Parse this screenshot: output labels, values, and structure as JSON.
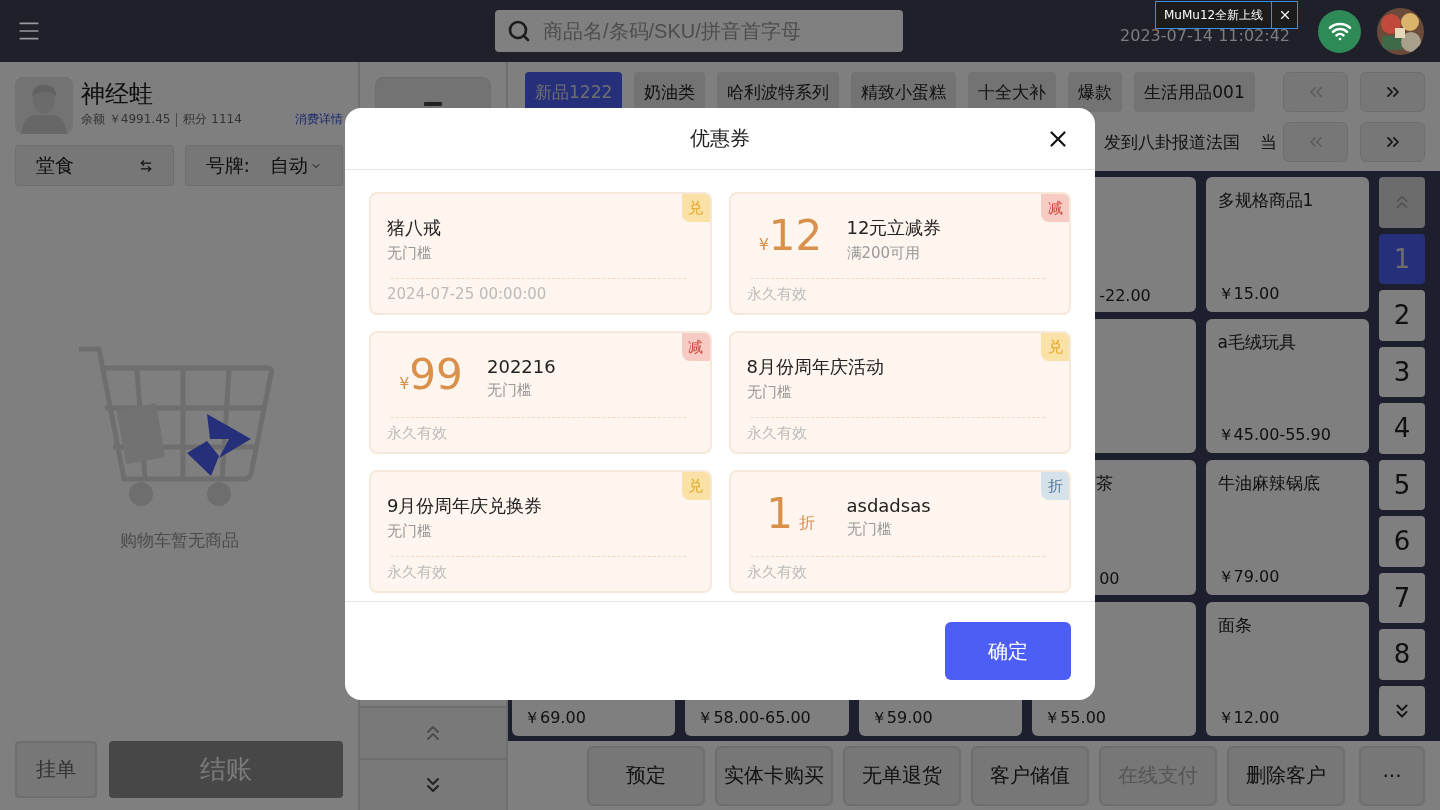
{
  "top_bar": {
    "search": {
      "placeholder": "商品名/条码/SKU/拼音首字母"
    },
    "datetime": "2023-07-14 11:02:42",
    "notice": {
      "text": "MuMu12全新上线"
    }
  },
  "customer": {
    "name": "神经蛙",
    "balance": "余额 ￥4991.45",
    "points": "积分 1114",
    "details_link": "消费详情"
  },
  "order_type": {
    "label": "堂食"
  },
  "number_plate": {
    "label": "号牌:",
    "value": "自动"
  },
  "cart": {
    "empty_text": "购物车暂无商品"
  },
  "cart_actions": [
    {
      "label": "挂单",
      "kind": "secondary",
      "disabled": false
    },
    {
      "label": "结账",
      "kind": "primary",
      "disabled": true
    }
  ],
  "categories": [
    {
      "label": "新品1222",
      "selected": true
    },
    {
      "label": "奶油类",
      "selected": false
    },
    {
      "label": "哈利波特系列",
      "selected": false
    },
    {
      "label": "精致小蛋糕",
      "selected": false
    },
    {
      "label": "十全大补",
      "selected": false
    },
    {
      "label": "爆款",
      "selected": false
    },
    {
      "label": "生活用品001",
      "selected": false
    }
  ],
  "subcategories": [
    {
      "label": "发到八卦报道法国"
    },
    {
      "label": "当"
    }
  ],
  "products": [
    [
      {
        "kind": "hidden"
      },
      {
        "kind": "hidden"
      },
      {
        "kind": "hidden"
      },
      {
        "kind": "partial",
        "price": "-22.00"
      },
      {
        "kind": "full",
        "name": "多规格商品1",
        "price": "￥15.00"
      }
    ],
    [
      {
        "kind": "hidden"
      },
      {
        "kind": "hidden"
      },
      {
        "kind": "hidden"
      },
      {
        "kind": "covered"
      },
      {
        "kind": "full",
        "name": "a毛绒玩具",
        "price": "￥45.00-55.90"
      }
    ],
    [
      {
        "kind": "hidden"
      },
      {
        "kind": "hidden"
      },
      {
        "kind": "hidden"
      },
      {
        "kind": "partial",
        "name": "茶",
        "price": "00"
      },
      {
        "kind": "full",
        "name": "牛油麻辣锅底",
        "price": "￥79.00"
      }
    ],
    [
      {
        "kind": "full",
        "price": "￥69.00"
      },
      {
        "kind": "full",
        "price": "￥58.00-65.00"
      },
      {
        "kind": "full",
        "price": "￥59.00"
      },
      {
        "kind": "full",
        "price": "￥55.00"
      },
      {
        "kind": "full",
        "name": "面条",
        "price": "￥12.00"
      }
    ]
  ],
  "pages": [
    {
      "label": "1",
      "selected": true
    },
    {
      "label": "2",
      "selected": false
    },
    {
      "label": "3",
      "selected": false
    },
    {
      "label": "4",
      "selected": false
    },
    {
      "label": "5",
      "selected": false
    },
    {
      "label": "6",
      "selected": false
    },
    {
      "label": "7",
      "selected": false
    },
    {
      "label": "8",
      "selected": false
    }
  ],
  "bottom_actions": [
    {
      "label": "预定",
      "disabled": false
    },
    {
      "label": "实体卡购买",
      "disabled": false
    },
    {
      "label": "无单退货",
      "disabled": false
    },
    {
      "label": "客户储值",
      "disabled": false
    },
    {
      "label": "在线支付",
      "disabled": true
    },
    {
      "label": "删除客户",
      "disabled": false
    },
    {
      "label": "···",
      "disabled": false
    }
  ],
  "dialog": {
    "title": "优惠券",
    "confirm": "确定",
    "coupons": [
      {
        "title": "猪八戒",
        "condition": "无门槛",
        "validity": "2024-07-25 00:00:00",
        "tag": {
          "text": "兑",
          "kind": "exchange"
        }
      },
      {
        "amount": {
          "prefix": "¥",
          "value": "12"
        },
        "title": "12元立减券",
        "condition": "满200可用",
        "validity": "永久有效",
        "tag": {
          "text": "减",
          "kind": "reduce"
        }
      },
      {
        "amount": {
          "prefix": "¥",
          "value": "99"
        },
        "title": "202216",
        "condition": "无门槛",
        "validity": "永久有效",
        "tag": {
          "text": "减",
          "kind": "reduce"
        }
      },
      {
        "title": "8月份周年庆活动",
        "condition": "无门槛",
        "validity": "永久有效",
        "tag": {
          "text": "兑",
          "kind": "exchange"
        }
      },
      {
        "title": "9月份周年庆兑换券",
        "condition": "无门槛",
        "validity": "永久有效",
        "tag": {
          "text": "兑",
          "kind": "exchange"
        }
      },
      {
        "amount": {
          "value": "1",
          "suffix": "折"
        },
        "title": "asdadsas",
        "condition": "无门槛",
        "validity": "永久有效",
        "tag": {
          "text": "折",
          "kind": "discount"
        }
      }
    ]
  }
}
